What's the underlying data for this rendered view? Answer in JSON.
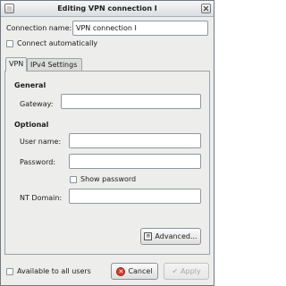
{
  "window": {
    "title": "Editing VPN connection I"
  },
  "connection": {
    "name_label": "Connection name:",
    "name_label_mnemonic": "n",
    "name_value": "VPN connection I",
    "connect_auto_label": "Connect automatically"
  },
  "tabs": [
    {
      "label": "VPN",
      "active": true
    },
    {
      "label": "IPv4 Settings",
      "active": false
    }
  ],
  "vpn": {
    "general_heading": "General",
    "gateway_label": "Gateway:",
    "optional_heading": "Optional",
    "username_label": "User name:",
    "password_label": "Password:",
    "show_password_label": "Show password",
    "nt_domain_label": "NT Domain:",
    "advanced_label": "Advanced..."
  },
  "footer": {
    "available_label": "Available to all users",
    "cancel_label": "Cancel",
    "apply_label": "Apply"
  }
}
